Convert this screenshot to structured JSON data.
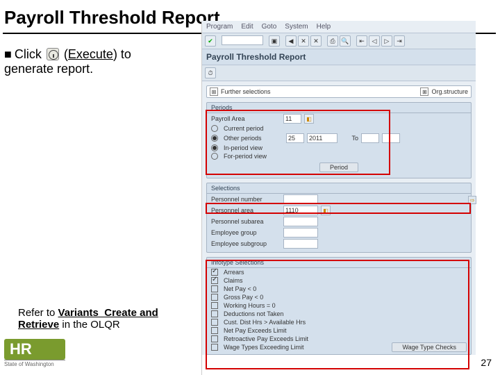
{
  "title": "Payroll Threshold Report",
  "instruction": {
    "prefix": "Click",
    "exec": "Execute",
    "suffix": ") to",
    "line2": "generate report."
  },
  "sap": {
    "menu": [
      "Program",
      "Edit",
      "Goto",
      "System",
      "Help"
    ],
    "app_title": "Payroll Threshold Report",
    "further": {
      "label": "Further selections",
      "org": "Org.structure"
    },
    "periods": {
      "header": "Periods",
      "area_label": "Payroll Area",
      "area_val": "11",
      "r1": "Current period",
      "r2": "Other periods",
      "r2_val1": "25",
      "r2_val2": "2011",
      "r2_to": "To",
      "r3": "In-period view",
      "r4": "For-period view",
      "btn": "Period"
    },
    "selections": {
      "header": "Selections",
      "rows": [
        "Personnel number",
        "Personnel area",
        "Personnel subarea",
        "Employee group",
        "Employee subgroup"
      ],
      "pa_val": "1110"
    },
    "infotype": {
      "header": "Infotype Selections",
      "items": [
        {
          "c": true,
          "t": "Arrears"
        },
        {
          "c": true,
          "t": "Claims"
        },
        {
          "c": false,
          "t": "Net Pay < 0"
        },
        {
          "c": false,
          "t": "Gross Pay < 0"
        },
        {
          "c": false,
          "t": "Working Hours = 0"
        },
        {
          "c": false,
          "t": "Deductions not Taken"
        },
        {
          "c": false,
          "t": "Cust. Dist Hrs > Available Hrs"
        },
        {
          "c": false,
          "t": "Net Pay Exceeds Limit"
        },
        {
          "c": false,
          "t": "Retroactive Pay Exceeds Limit"
        },
        {
          "c": false,
          "t": "Wage Types Exceeding Limit"
        }
      ],
      "wt_btn": "Wage Type Checks"
    }
  },
  "footer": {
    "refer": "Refer to ",
    "link": "Variants_Create and Retrieve",
    "rest": " in the OLQR"
  },
  "hr": {
    "mark": "HR",
    "sub": "State of Washington"
  },
  "page": "27"
}
